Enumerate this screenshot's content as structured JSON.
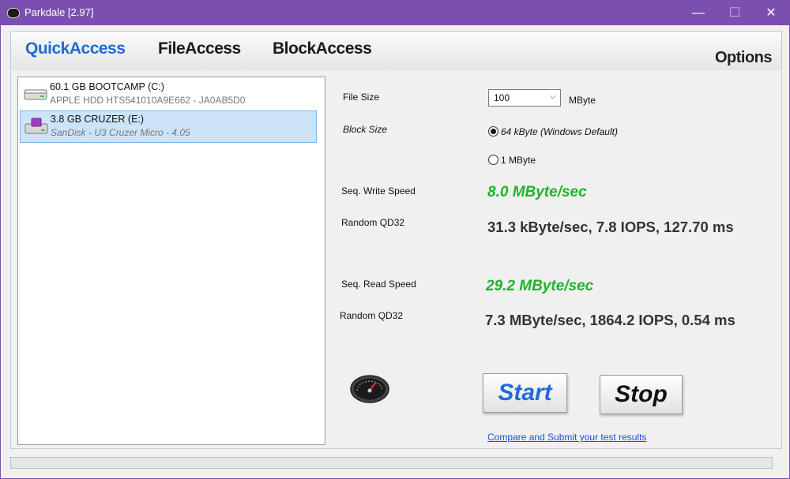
{
  "window": {
    "title": "Parkdale [2.97]",
    "controls": {
      "minimize": "—",
      "maximize": "☐",
      "close": "✕"
    }
  },
  "tabs": [
    {
      "label": "QuickAccess",
      "active": true
    },
    {
      "label": "FileAccess",
      "active": false
    },
    {
      "label": "BlockAccess",
      "active": false
    }
  ],
  "options_label": "Options",
  "drives": [
    {
      "name": "60.1 GB BOOTCAMP (C:)",
      "detail": "APPLE HDD HTS541010A9E662 - JA0AB5D0",
      "icon": "hdd-icon",
      "selected": false
    },
    {
      "name": "3.8 GB CRUZER (E:)",
      "detail": "SanDisk - U3 Cruzer Micro - 4.05",
      "icon": "usb-drive-icon",
      "selected": true
    }
  ],
  "settings": {
    "file_size_label": "File Size",
    "file_size_value": "100",
    "file_size_unit": "MByte",
    "block_size_label": "Block Size",
    "block_options": [
      {
        "label": "64 kByte (Windows Default)",
        "checked": true
      },
      {
        "label": "1 MByte",
        "checked": false
      }
    ]
  },
  "results": {
    "seq_write_label": "Seq. Write Speed",
    "seq_write_value": "8.0 MByte/sec",
    "random_write_label": "Random QD32",
    "random_write_value": "31.3 kByte/sec, 7.8 IOPS, 127.70 ms",
    "seq_read_label": "Seq. Read Speed",
    "seq_read_value": "29.2 MByte/sec",
    "random_read_label": "Random QD32",
    "random_read_value": "7.3 MByte/sec, 1864.2 IOPS, 0.54 ms"
  },
  "actions": {
    "start_label": "Start",
    "stop_label": "Stop",
    "compare_link": "Compare and Submit your test results"
  },
  "colors": {
    "titlebar": "#7b4fb0",
    "active_tab": "#1f6bd6",
    "speed_green": "#22b22e",
    "selection": "#cce4f7"
  },
  "icons": {
    "gauge": "speedometer-icon"
  }
}
